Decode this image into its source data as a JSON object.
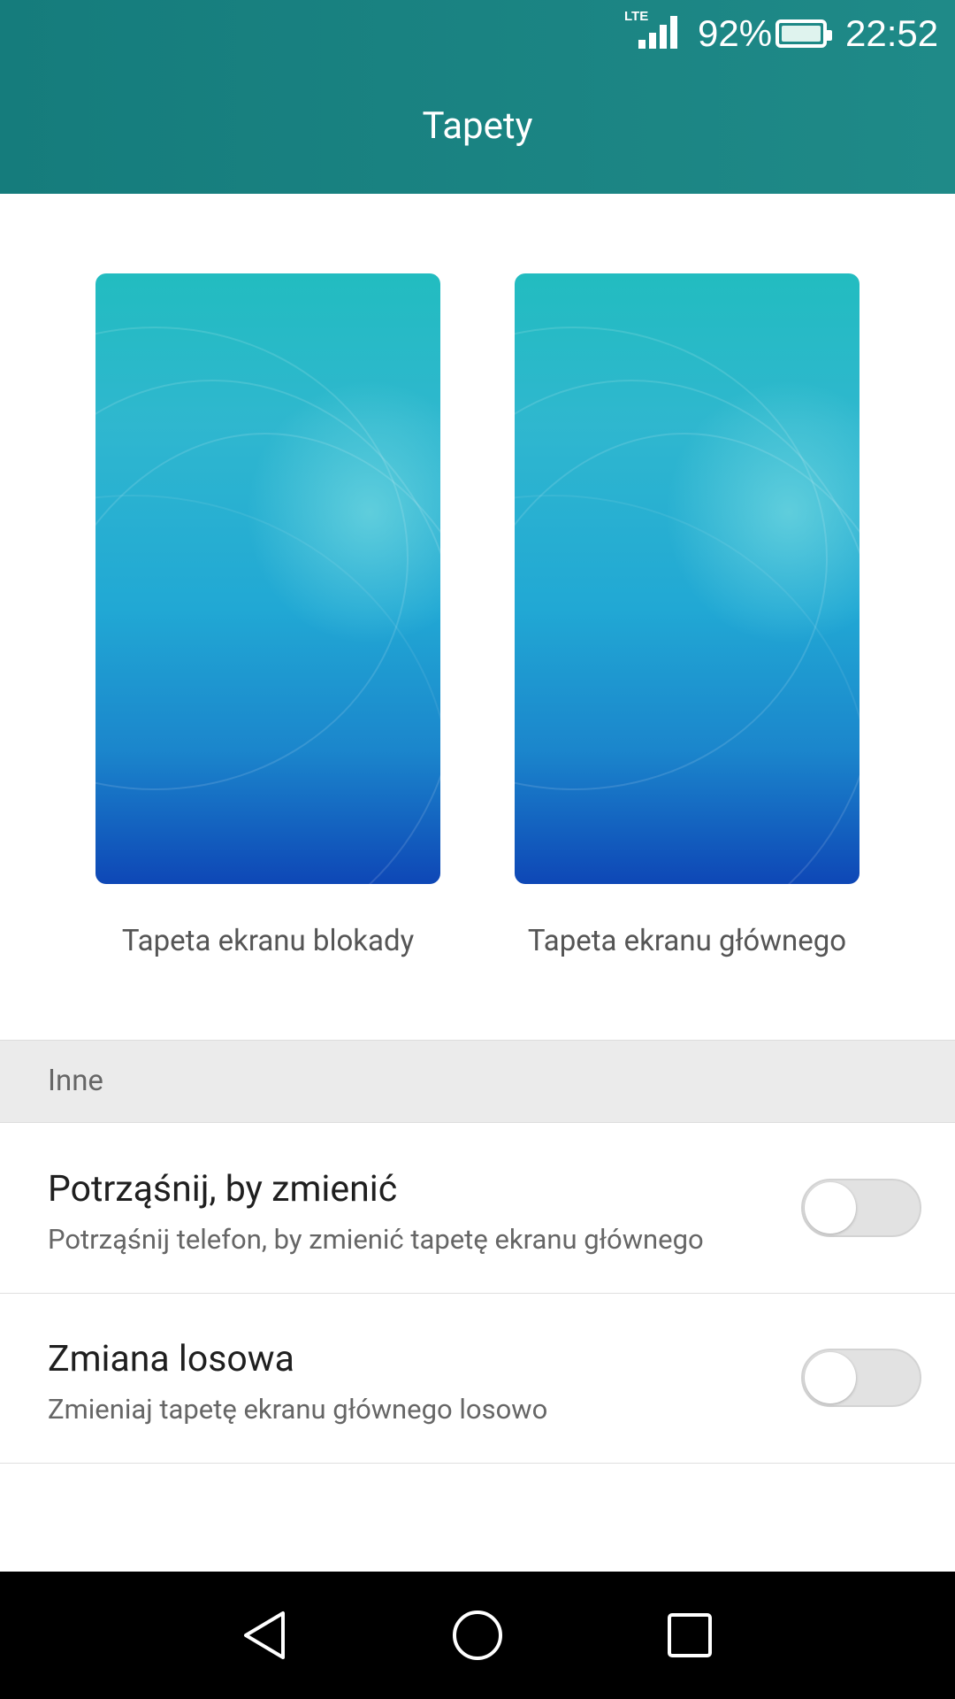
{
  "status_bar": {
    "network": "LTE",
    "battery_percent": "92%",
    "battery_level": 0.92,
    "time": "22:52",
    "icons": [
      "signal-icon",
      "battery-icon"
    ]
  },
  "header": {
    "title": "Tapety",
    "background_color": "#1a8282"
  },
  "wallpapers": [
    {
      "label": "Tapeta ekranu blokady"
    },
    {
      "label": "Tapeta ekranu głównego"
    }
  ],
  "section": {
    "title": "Inne"
  },
  "settings": [
    {
      "title": "Potrząśnij, by zmienić",
      "subtitle": "Potrząśnij telefon, by zmienić tapetę ekranu głównego",
      "enabled": false
    },
    {
      "title": "Zmiana losowa",
      "subtitle": "Zmieniaj tapetę ekranu głównego losowo",
      "enabled": false
    }
  ],
  "nav_bar": {
    "icons": [
      "back-icon",
      "home-icon",
      "recent-apps-icon"
    ]
  }
}
